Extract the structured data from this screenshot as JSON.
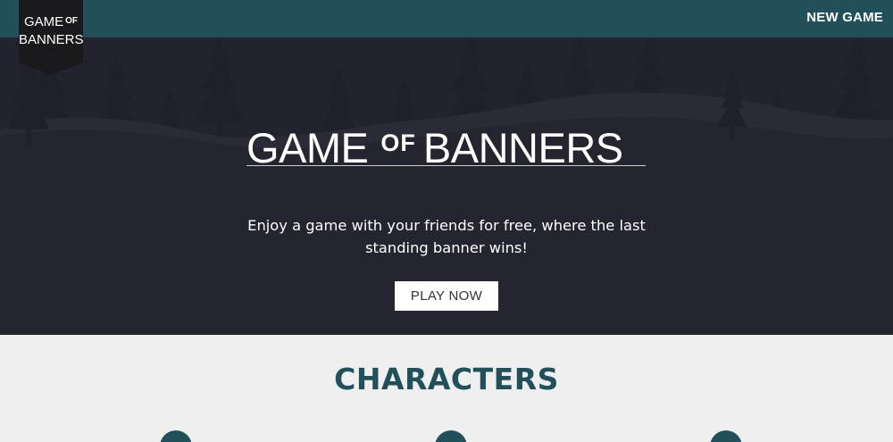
{
  "logo": {
    "line1_main": "GAME",
    "line1_of": "OF",
    "line2": "BANNERS"
  },
  "nav": {
    "new_game": "NEW GAME"
  },
  "hero": {
    "title_game": "GAME",
    "title_of": "OF",
    "title_banners": "BANNERS",
    "subtitle": "Enjoy a game with your friends for free, where the last standing banner wins!",
    "play_button": "PLAY NOW"
  },
  "characters": {
    "heading": "CHARACTERS",
    "avatars": 3
  },
  "colors": {
    "topbar": "#22505a",
    "hero_bg": "#22232e",
    "hills": "#34353f",
    "trees": "#1f202a",
    "page_bg": "#efefef",
    "heading": "#22505a"
  }
}
